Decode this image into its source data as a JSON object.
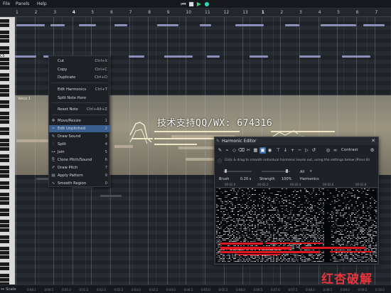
{
  "menubar": {
    "items": [
      "File",
      "Panels",
      "Help"
    ],
    "transport": [
      "rewind",
      "stop",
      "play",
      "record"
    ]
  },
  "ruler": {
    "bars": [
      "1",
      "2",
      "3",
      "4",
      "5",
      "6",
      "7",
      "8",
      "9",
      "10",
      "11",
      "12",
      "13",
      "1",
      "2",
      "3",
      "4",
      "5",
      "6",
      "7",
      "8"
    ],
    "strong": [
      3,
      13
    ]
  },
  "piano": {
    "label": "C5"
  },
  "track": {
    "name": "Voice 1"
  },
  "context_menu": {
    "items": [
      {
        "label": "Cut",
        "shortcut": "Ctrl+X",
        "icon": ""
      },
      {
        "label": "Copy",
        "shortcut": "Ctrl+C",
        "icon": ""
      },
      {
        "label": "Duplicate",
        "shortcut": "Ctrl+D",
        "icon": ""
      },
      {
        "label": "Edit Harmonics",
        "shortcut": "Ctrl+T",
        "icon": ""
      },
      {
        "label": "Split Note Here",
        "shortcut": "",
        "icon": ""
      },
      {
        "label": "Reset Note",
        "shortcut": "Ctrl+Alt+Z",
        "icon": ""
      },
      {
        "label": "Move/Resize",
        "shortcut": "1",
        "icon": "move-icon"
      },
      {
        "label": "Edit Unpitched",
        "shortcut": "2",
        "icon": "wave-icon",
        "highlighted": true
      },
      {
        "label": "Draw Sound",
        "shortcut": "3",
        "icon": "pencil-icon"
      },
      {
        "label": "Split",
        "shortcut": "4",
        "icon": "split-icon"
      },
      {
        "label": "Join",
        "shortcut": "5",
        "icon": "join-icon"
      },
      {
        "label": "Clone Pitch/Sound",
        "shortcut": "6",
        "icon": "clone-icon"
      },
      {
        "label": "Draw Pitch",
        "shortcut": "7",
        "icon": "pitch-pencil-icon"
      },
      {
        "label": "Apply Pattern",
        "shortcut": "9",
        "icon": "pattern-icon"
      },
      {
        "label": "Smooth Region",
        "shortcut": "0",
        "icon": "smooth-icon"
      }
    ]
  },
  "watermark": "技术支持QQ/WX: 674316",
  "brand_watermark": "红杏破解",
  "harmonic_editor": {
    "title": "Harmonic Editor",
    "toolbar_label": "Contrast",
    "help_text": "Click & drag to smooth individual harmonic levels out, using the settings below (Press B)",
    "params": {
      "brush_label": "Brush",
      "brush_value": "0.20 s",
      "strength_label": "Strength",
      "strength_value": "100%",
      "harmonics_label": "Harmonics",
      "harmonics_value": "All"
    },
    "time_ticks": [
      "00:02.0",
      "00:02.2",
      "00:02.4",
      "00:02.6",
      "00:02.8"
    ],
    "colors": {
      "accent": "#3a6fb0",
      "spectrum_high": "#e01820"
    }
  },
  "bottom": {
    "scale_label": "Scale",
    "ticks": [
      "0:00.1",
      "0:00.5",
      "0:01.0",
      "0:01.5",
      "0:02.0",
      "0:02.5",
      "0:03.0",
      "0:03.5",
      "0:04.0",
      "0:04.5",
      "0:05.0",
      "0:05.5",
      "0:06.0",
      "0:06.5",
      "0:07.0",
      "0:07.5",
      "0:08.0",
      "0:08.5",
      "0:09.0",
      "0:09.5",
      "0:10.0"
    ]
  }
}
